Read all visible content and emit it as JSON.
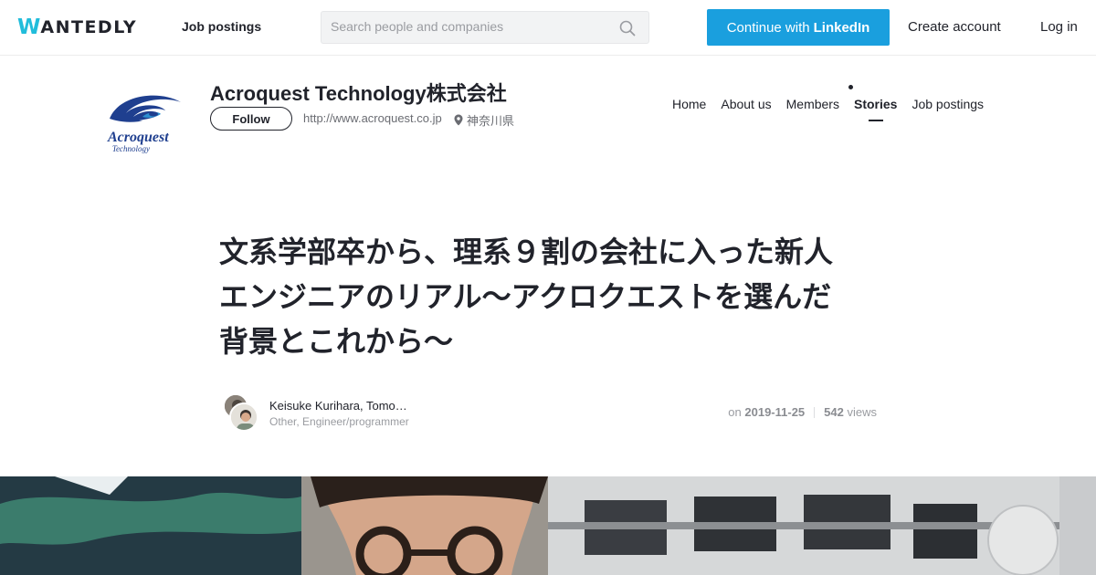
{
  "header": {
    "logo_first": "W",
    "logo_rest": "ANTEDLY",
    "nav_jobs": "Job postings",
    "search_placeholder": "Search people and companies",
    "linkedin_prefix": "Continue with",
    "linkedin_brand": "LinkedIn",
    "create_account": "Create account",
    "login": "Log in",
    "colors": {
      "brand": "#21bddb",
      "linkedin_button": "#1a9fde"
    }
  },
  "company": {
    "name": "Acroquest Technology株式会社",
    "follow": "Follow",
    "url": "http://www.acroquest.co.jp",
    "location": "神奈川県",
    "logo_text_main": "Acroquest",
    "logo_text_sub": "Technology",
    "nav": [
      {
        "label": "Home",
        "active": false
      },
      {
        "label": "About us",
        "active": false
      },
      {
        "label": "Members",
        "active": false
      },
      {
        "label": "Stories",
        "active": true
      },
      {
        "label": "Job postings",
        "active": false
      }
    ]
  },
  "article": {
    "title_lines": [
      "文系学部卒から、理系９割の会社に入った新人",
      "エンジニアのリアル～アクロクエストを選んだ",
      "背景とこれから～"
    ],
    "authors": "Keisuke Kurihara, Tomo…",
    "roles": "Other, Engineer/programmer",
    "date_prefix": "on",
    "date": "2019-11-25",
    "views": "542",
    "views_label": "views"
  }
}
